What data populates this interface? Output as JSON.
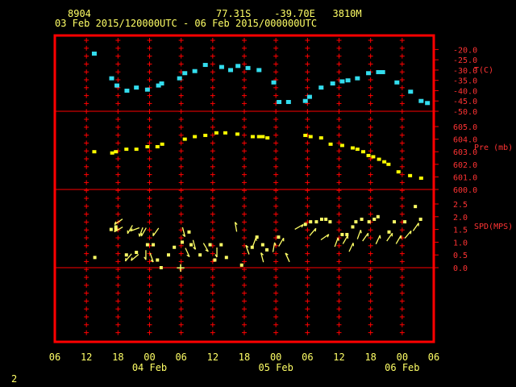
{
  "header": {
    "station": "8904",
    "location": "77.31S    -39.70E   3810M",
    "range": "03 Feb 2015/120000UTC - 06 Feb 2015/000000UTC"
  },
  "page_number": "2",
  "colors": {
    "frame": "#ff0000",
    "text": "#ffff66",
    "temperature": "#33ddee",
    "pressure": "#ffff00",
    "wind": "#ffff66",
    "axis_labels": "#ff3333"
  },
  "chart_data": [
    {
      "type": "scatter",
      "panel": "temperature",
      "ylabel": "T(C)",
      "ylim": [
        -50.0,
        -17.5
      ],
      "yticks": [
        -20.0,
        -25.0,
        -30.0,
        -35.0,
        -40.0,
        -45.0,
        -50.0
      ],
      "ytick_labels": [
        "-20.0",
        "-25.0",
        "-30.0",
        "-35.0",
        "-40.0",
        "-45.0",
        "-50.0"
      ],
      "x": [
        13.5,
        16.8,
        17.8,
        19.7,
        21.5,
        23.6,
        25.7,
        26.3,
        29.7,
        30.7,
        32.6,
        34.6,
        37.7,
        39.4,
        40.8,
        42.7,
        44.8,
        47.6,
        48.6,
        50.4,
        53.6,
        54.4,
        56.6,
        58.8,
        60.6,
        61.7,
        63.5,
        65.6,
        67.5,
        68.3,
        71.0,
        73.6,
        75.6,
        76.8
      ],
      "y": [
        -22.0,
        -34.0,
        -37.5,
        -40.0,
        -38.5,
        -39.5,
        -37.5,
        -36.5,
        -34.0,
        -31.5,
        -30.5,
        -27.5,
        -28.5,
        -30.0,
        -28.0,
        -29.0,
        -30.0,
        -36.0,
        -45.5,
        -45.5,
        -45.0,
        -43.0,
        -38.5,
        -36.5,
        -35.5,
        -35.0,
        -34.0,
        -31.5,
        -31.0,
        -31.0,
        -36.0,
        -40.5,
        -45.0,
        -46.0
      ]
    },
    {
      "type": "scatter",
      "panel": "pressure",
      "ylabel": "Pre (mb)",
      "ylim": [
        600.0,
        605.0
      ],
      "yticks": [
        605.0,
        604.0,
        603.0,
        602.0,
        601.0,
        600.0
      ],
      "ytick_labels": [
        "605.0",
        "604.0",
        "603.0",
        "602.0",
        "601.0",
        "600.0"
      ],
      "x": [
        13.5,
        16.9,
        17.6,
        19.6,
        21.5,
        23.6,
        25.5,
        26.4,
        30.7,
        32.6,
        34.6,
        36.7,
        38.4,
        40.7,
        43.6,
        44.8,
        45.5,
        46.4,
        53.6,
        54.6,
        56.6,
        58.4,
        60.6,
        62.6,
        63.5,
        64.6,
        65.6,
        66.5,
        67.6,
        68.6,
        69.4,
        71.3,
        73.5,
        75.6
      ],
      "y": [
        603.0,
        602.9,
        603.0,
        603.2,
        603.2,
        603.4,
        603.4,
        603.6,
        604.0,
        604.2,
        604.3,
        604.5,
        604.5,
        604.4,
        604.2,
        604.2,
        604.2,
        604.1,
        604.3,
        604.2,
        604.1,
        603.6,
        603.5,
        603.3,
        603.2,
        603.0,
        602.7,
        602.6,
        602.4,
        602.2,
        602.0,
        601.4,
        601.1,
        600.9
      ]
    },
    {
      "type": "scatter",
      "panel": "wind",
      "ylabel": "SPD(MPS)",
      "ylim": [
        0.0,
        2.5
      ],
      "yticks": [
        2.5,
        2.0,
        1.5,
        1.0,
        0.5,
        0.0
      ],
      "ytick_labels": [
        "2.5",
        "2.0",
        "1.5",
        "1.0",
        "0.5",
        "0.0"
      ],
      "x": [
        13.6,
        16.7,
        17.6,
        17.6,
        19.6,
        21.5,
        23.6,
        24.7,
        25.5,
        26.2,
        27.6,
        28.7,
        30.2,
        31.5,
        31.9,
        33.6,
        35.5,
        36.4,
        37.6,
        38.6,
        41.5,
        43.5,
        44.4,
        45.5,
        46.3,
        48.5,
        53.6,
        54.6,
        55.7,
        56.7,
        57.5,
        58.3,
        60.6,
        61.5,
        62.6,
        63.2,
        64.3,
        65.7,
        66.7,
        67.4,
        69.5,
        70.5,
        72.5,
        74.5,
        75.5
      ],
      "y": [
        0.4,
        1.5,
        1.5,
        1.6,
        0.5,
        0.6,
        0.9,
        0.9,
        0.3,
        0.0,
        0.5,
        0.8,
        1.0,
        1.4,
        0.9,
        0.5,
        0.9,
        0.3,
        0.9,
        0.4,
        0.1,
        0.8,
        1.2,
        0.9,
        0.7,
        1.2,
        1.7,
        1.8,
        1.8,
        1.9,
        1.9,
        1.8,
        1.3,
        1.3,
        1.6,
        1.8,
        1.9,
        1.8,
        1.9,
        2.0,
        1.4,
        1.8,
        1.8,
        2.4,
        1.9
      ],
      "markers": [
        {
          "x": 18.1,
          "y": 1.8,
          "a": 235
        },
        {
          "x": 18.1,
          "y": 1.5,
          "a": 240
        },
        {
          "x": 20.0,
          "y": 0.4,
          "a": 220
        },
        {
          "x": 20.3,
          "y": 1.5,
          "a": 210
        },
        {
          "x": 21.2,
          "y": 0.4,
          "a": 230
        },
        {
          "x": 21.2,
          "y": 1.5,
          "a": 250
        },
        {
          "x": 22.4,
          "y": 1.4,
          "a": 200
        },
        {
          "x": 22.9,
          "y": 1.4,
          "a": 210
        },
        {
          "x": 23.3,
          "y": 0.5,
          "a": 180
        },
        {
          "x": 24.4,
          "y": 0.4,
          "a": 160
        },
        {
          "x": 25.2,
          "y": 1.4,
          "a": 215
        },
        {
          "x": 30.5,
          "y": 1.4,
          "a": 165
        },
        {
          "x": 31.2,
          "y": 0.6,
          "a": 155
        },
        {
          "x": 32.5,
          "y": 0.9,
          "a": 165
        },
        {
          "x": 34.7,
          "y": 0.8,
          "a": 150
        },
        {
          "x": 36.8,
          "y": 0.6,
          "a": 180
        },
        {
          "x": 40.4,
          "y": 1.6,
          "a": 350
        },
        {
          "x": 42.6,
          "y": 0.7,
          "a": 340
        },
        {
          "x": 43.9,
          "y": 1.0,
          "a": 20
        },
        {
          "x": 45.4,
          "y": 0.4,
          "a": 345
        },
        {
          "x": 47.6,
          "y": 0.8,
          "a": 10
        },
        {
          "x": 49.0,
          "y": 1.0,
          "a": 30
        },
        {
          "x": 50.2,
          "y": 0.4,
          "a": 335
        },
        {
          "x": 52.4,
          "y": 1.6,
          "a": 60
        },
        {
          "x": 55.0,
          "y": 1.4,
          "a": 40
        },
        {
          "x": 57.3,
          "y": 1.2,
          "a": 55
        },
        {
          "x": 59.5,
          "y": 1.0,
          "a": 20
        },
        {
          "x": 61.2,
          "y": 1.1,
          "a": 30
        },
        {
          "x": 62.3,
          "y": 0.8,
          "a": 25
        },
        {
          "x": 63.8,
          "y": 1.3,
          "a": 20
        },
        {
          "x": 65.0,
          "y": 1.2,
          "a": 35
        },
        {
          "x": 67.4,
          "y": 1.1,
          "a": 25
        },
        {
          "x": 69.6,
          "y": 1.2,
          "a": 35
        },
        {
          "x": 71.3,
          "y": 1.1,
          "a": 30
        },
        {
          "x": 73.1,
          "y": 1.3,
          "a": 40
        },
        {
          "x": 74.6,
          "y": 1.6,
          "a": 35
        }
      ],
      "annotations": [
        {
          "x": 29.9,
          "y": 0.0,
          "text": "+"
        }
      ]
    }
  ],
  "x_axis": {
    "xlim": [
      6,
      78
    ],
    "ticks": [
      6,
      12,
      18,
      24,
      30,
      36,
      42,
      48,
      54,
      60,
      66,
      72,
      78
    ],
    "tick_labels": [
      "06",
      "12",
      "18",
      "00",
      "06",
      "12",
      "18",
      "00",
      "06",
      "12",
      "18",
      "00",
      "06"
    ],
    "date_labels": [
      {
        "x": 24,
        "text": "04 Feb"
      },
      {
        "x": 48,
        "text": "05 Feb"
      },
      {
        "x": 72,
        "text": "06 Feb"
      }
    ]
  }
}
